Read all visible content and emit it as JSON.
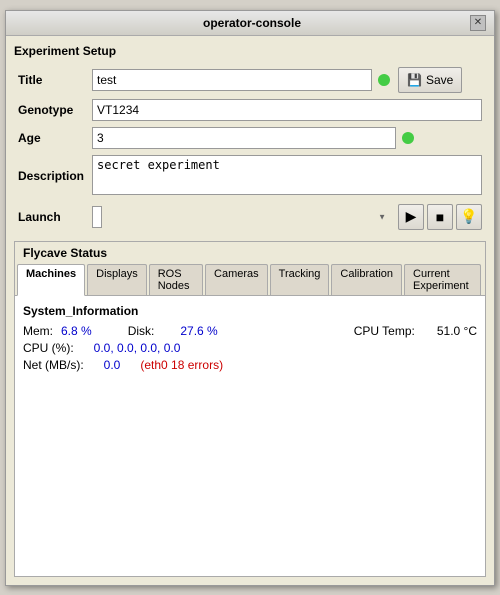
{
  "window": {
    "title": "operator-console"
  },
  "experiment_setup": {
    "header": "Experiment Setup",
    "title_label": "Title",
    "title_value": "test",
    "genotype_label": "Genotype",
    "genotype_value": "VT1234",
    "age_label": "Age",
    "age_value": "3",
    "description_label": "Description",
    "description_value": "secret experiment",
    "launch_label": "Launch",
    "launch_placeholder": "",
    "save_label": "Save"
  },
  "flycave": {
    "header": "Flycave Status",
    "tabs": [
      {
        "id": "machines",
        "label": "Machines",
        "active": true
      },
      {
        "id": "displays",
        "label": "Displays",
        "active": false
      },
      {
        "id": "ros-nodes",
        "label": "ROS Nodes",
        "active": false
      },
      {
        "id": "cameras",
        "label": "Cameras",
        "active": false
      },
      {
        "id": "tracking",
        "label": "Tracking",
        "active": false
      },
      {
        "id": "calibration",
        "label": "Calibration",
        "active": false
      },
      {
        "id": "current-experiment",
        "label": "Current Experiment",
        "active": false
      }
    ],
    "system_info": {
      "header": "System_Information",
      "mem_label": "Mem:",
      "mem_value": "6.8 %",
      "disk_label": "Disk:",
      "disk_value": "27.6 %",
      "cpu_temp_label": "CPU Temp:",
      "cpu_temp_value": "51.0 °C",
      "cpu_label": "CPU (%):",
      "cpu_value": "0.0,  0.0,  0.0,  0.0",
      "net_label": "Net (MB/s):",
      "net_value": "0.0",
      "net_error": "eth0 18 errors"
    }
  },
  "icons": {
    "play": "▶",
    "stop": "■",
    "light": "💡",
    "save": "💾",
    "close": "✕"
  },
  "colors": {
    "indicator_green": "#44cc44",
    "value_blue": "#0000cc",
    "error_red": "#cc0000"
  }
}
